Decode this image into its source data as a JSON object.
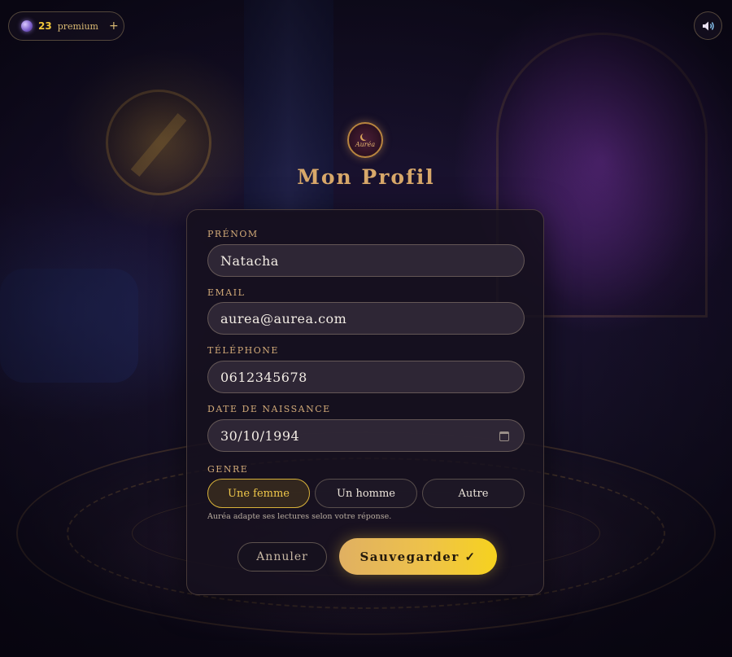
{
  "header": {
    "premium_count": "23",
    "premium_label": "premium",
    "add_symbol": "+",
    "icons": {
      "premium": "crystal-ball-icon",
      "sound": "speaker-icon"
    }
  },
  "logo": {
    "text": "Auréa"
  },
  "page": {
    "title": "Mon Profil"
  },
  "form": {
    "first_name": {
      "label": "PRÉNOM",
      "value": "Natacha"
    },
    "email": {
      "label": "EMAIL",
      "value": "aurea@aurea.com"
    },
    "phone": {
      "label": "TÉLÉPHONE",
      "value": "0612345678"
    },
    "birth_date": {
      "label": "DATE DE NAISSANCE",
      "value": "30/10/1994"
    },
    "gender": {
      "label": "GENRE",
      "options": [
        "Une femme",
        "Un homme",
        "Autre"
      ],
      "selected": "Une femme"
    },
    "hint": "Auréa adapte ses lectures selon votre réponse."
  },
  "actions": {
    "cancel": "Annuler",
    "save": "Sauvegarder ✓"
  },
  "colors": {
    "accent_gold": "#d8a86a",
    "save_gradient_start": "#e0b062",
    "save_gradient_end": "#f6d21e",
    "selected_border": "#d8b23a"
  }
}
